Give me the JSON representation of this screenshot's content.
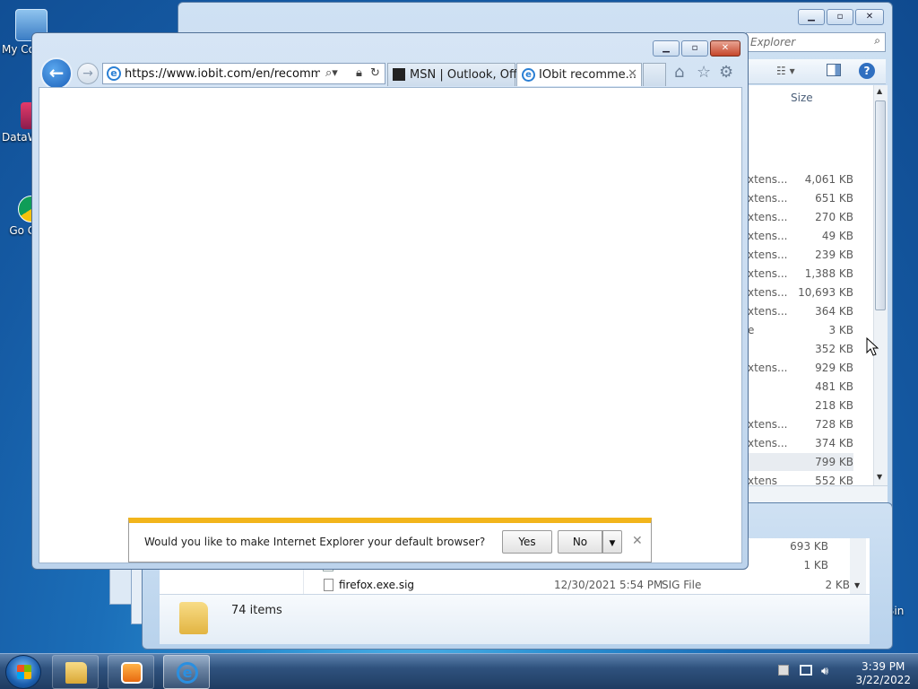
{
  "desktop": {
    "icons": [
      {
        "label": "My Co"
      },
      {
        "label": "DataW"
      },
      {
        "label": "Go Chr"
      },
      {
        "label": "cle Bin"
      }
    ]
  },
  "explorer": {
    "search_placeholder": "Explorer",
    "size_header": "Size",
    "rows": [
      {
        "type": "xtens...",
        "size": "4,061 KB"
      },
      {
        "type": "xtens...",
        "size": "651 KB"
      },
      {
        "type": "xtens...",
        "size": "270 KB"
      },
      {
        "type": "xtens...",
        "size": "49 KB"
      },
      {
        "type": "xtens...",
        "size": "239 KB"
      },
      {
        "type": "xtens...",
        "size": "1,388 KB"
      },
      {
        "type": "xtens...",
        "size": "10,693 KB"
      },
      {
        "type": "xtens...",
        "size": "364 KB"
      },
      {
        "type": "e",
        "size": "3 KB"
      },
      {
        "type": "",
        "size": "352 KB"
      },
      {
        "type": "xtens...",
        "size": "929 KB"
      },
      {
        "type": "",
        "size": "481 KB"
      },
      {
        "type": "",
        "size": "218 KB"
      },
      {
        "type": "xtens...",
        "size": "728 KB"
      },
      {
        "type": "xtens...",
        "size": "374 KB"
      },
      {
        "type": "",
        "size": "799 KB"
      },
      {
        "type": "xtens",
        "size": "552 KB"
      }
    ],
    "lower_rows": [
      {
        "name": "",
        "date": "",
        "type": "",
        "size": "693 KB"
      },
      {
        "name": "",
        "date": "",
        "type": "",
        "size": "1 KB"
      },
      {
        "name": "firefox.exe.sig",
        "date": "12/30/2021 5:54 PM",
        "type": "SIG File",
        "size": "2 KB"
      }
    ],
    "status_items": "74 items"
  },
  "ie": {
    "url": "https://www.iobit.com/en/recommend/it",
    "tabs": [
      {
        "label": "MSN | Outlook, Off..."
      },
      {
        "label": "IObit recomme..."
      }
    ],
    "notification": {
      "message": "Would you like to make Internet Explorer your default browser?",
      "yes": "Yes",
      "no": "No"
    }
  },
  "taskbar": {
    "time": "3:39 PM",
    "date": "3/22/2022"
  },
  "colors": {
    "notification_accent": "#f2b51b",
    "close_red": "#c5462b",
    "ie_blue": "#1a5fb8"
  }
}
